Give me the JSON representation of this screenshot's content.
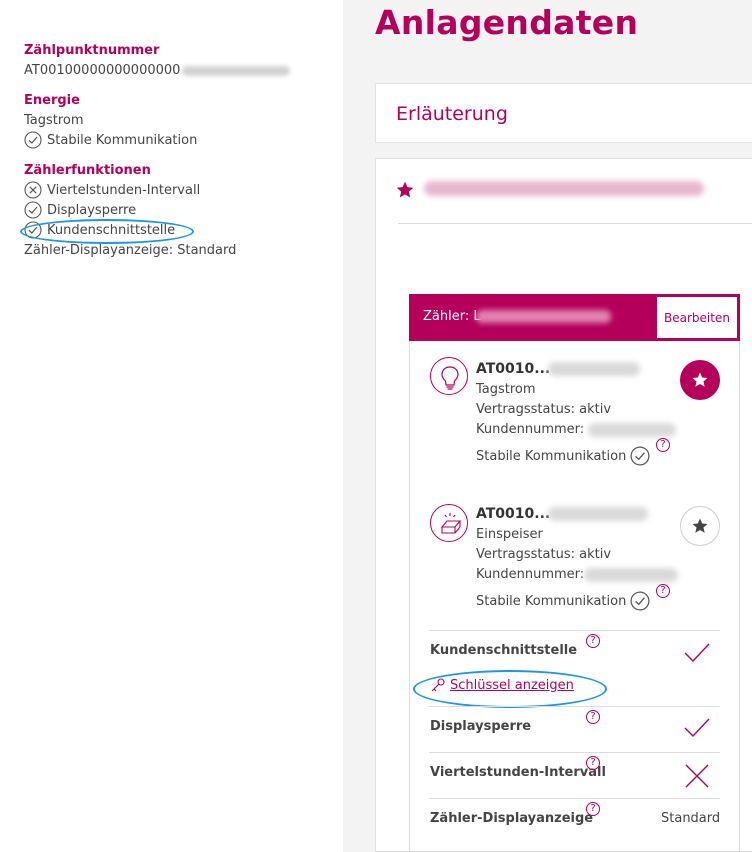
{
  "left": {
    "meter_point_heading": "Zählpunktnummer",
    "meter_point_value": "AT00100000000000000",
    "energy_heading": "Energie",
    "energy_value": "Tagstrom",
    "energy_status": "Stabile Kommunikation",
    "functions_heading": "Zählerfunktionen",
    "functions": [
      {
        "label": "Viertelstunden-Intervall",
        "icon": "x-circle-icon"
      },
      {
        "label": "Displaysperre",
        "icon": "check-circle-icon"
      },
      {
        "label": "Kundenschnittstelle",
        "icon": "check-circle-icon"
      }
    ],
    "display_mode": "Zähler-Displayanzeige: Standard"
  },
  "main": {
    "title": "Anlagendaten",
    "explanation": "Erläuterung",
    "card": {
      "header_label": "Zähler: L",
      "edit_button": "Bearbeiten",
      "meters": [
        {
          "id": "AT0010...",
          "type": "Tagstrom",
          "contract": "Vertragsstatus: aktiv",
          "customer": "Kundennummer:",
          "status": "Stabile Kommunikation",
          "icon": "lightbulb-icon",
          "favorite": true
        },
        {
          "id": "AT0010...",
          "type": "Einspeiser",
          "contract": "Vertragsstatus: aktiv",
          "customer": "Kundennummer:",
          "status": "Stabile Kommunikation",
          "icon": "solar-panel-icon",
          "favorite": false
        }
      ],
      "functions": {
        "customer_interface": "Kundenschnittstelle",
        "show_key": "Schlüssel anzeigen",
        "display_lock": "Displaysperre",
        "quarter_hour": "Viertelstunden-Intervall",
        "display_mode_label": "Zähler-Displayanzeige",
        "display_mode_value": "Standard"
      }
    }
  },
  "help_glyph": "?",
  "colors": {
    "brand": "#b5005b",
    "highlight": "#1e96e6"
  }
}
